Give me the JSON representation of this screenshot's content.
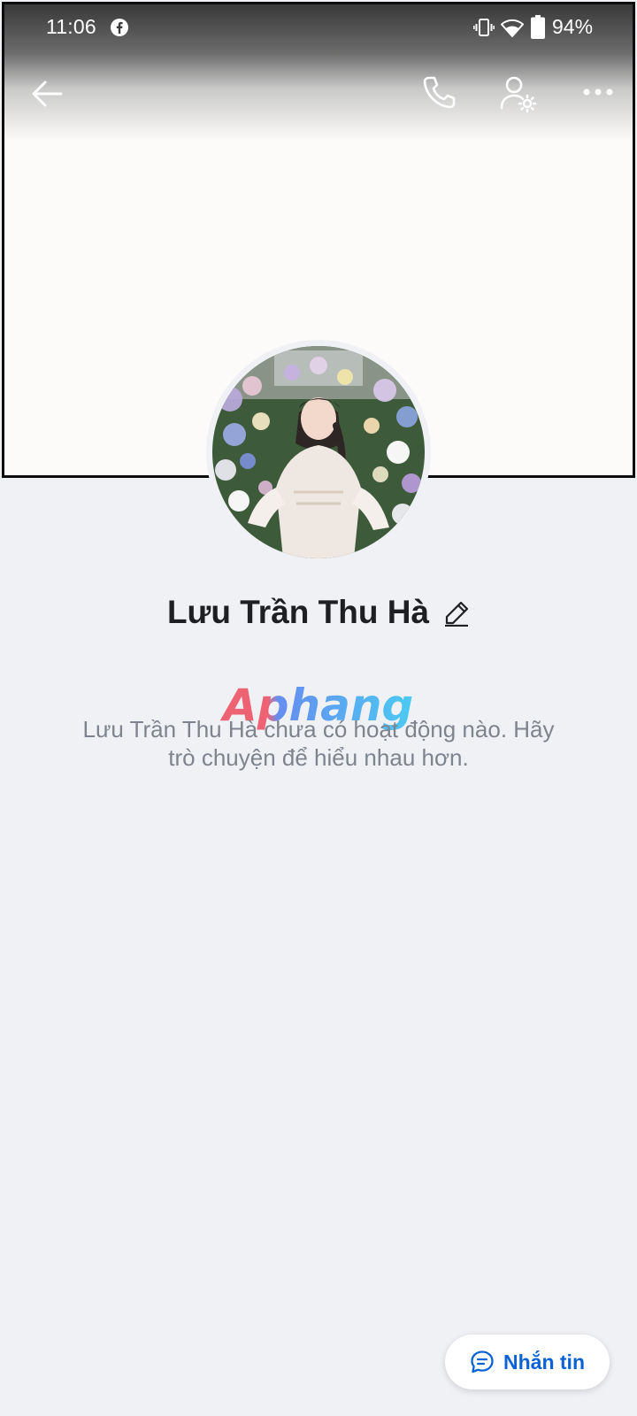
{
  "status_bar": {
    "time": "11:06",
    "battery_percent": "94%",
    "icons": [
      "facebook-icon",
      "vibrate-icon",
      "wifi-icon",
      "battery-icon"
    ]
  },
  "header": {
    "actions": [
      "back-arrow-icon",
      "phone-icon",
      "profile-settings-icon",
      "more-icon"
    ]
  },
  "profile": {
    "name": "Lưu Trần Thu Hà",
    "edit_icon": "pencil-icon"
  },
  "watermark": {
    "text": "Aphang"
  },
  "empty_state": {
    "line1": "Lưu Trần Thu Hà chưa có hoạt động nào. Hãy",
    "line2": "trò chuyện để hiểu nhau hơn."
  },
  "message_button": {
    "label": "Nhắn tin",
    "icon": "chat-bubble-icon"
  },
  "colors": {
    "background": "#f0f1f5",
    "accent": "#0a62d6",
    "name_text": "#1e1f23",
    "muted_text": "#7e848d"
  }
}
